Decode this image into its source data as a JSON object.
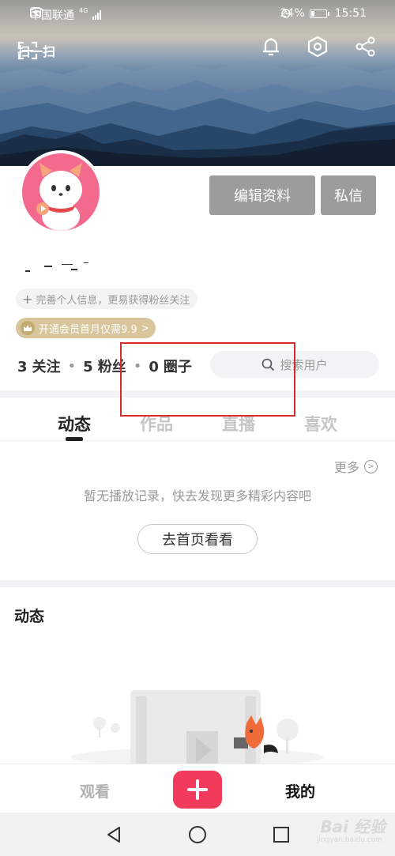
{
  "status_bar": {
    "carrier": "中国联通",
    "network": "4G",
    "battery": "24%",
    "time": "15:51",
    "battery_level": 0.24
  },
  "header": {
    "scan_label": "扫一扫",
    "icons": [
      "scan-icon",
      "bell-icon",
      "settings-hex-icon",
      "share-icon"
    ]
  },
  "profile": {
    "edit_button": "编辑资料",
    "message_button": "私信",
    "complete_info_tip": "完善个人信息，更易获得粉丝关注",
    "vip_promo": "开通会员首月仅需9.9",
    "stats": [
      {
        "value": "3",
        "label": "关注"
      },
      {
        "value": "5",
        "label": "粉丝"
      },
      {
        "value": "0",
        "label": "圈子"
      }
    ],
    "search_placeholder": "搜索用户"
  },
  "tabs": [
    {
      "label": "动态",
      "active": true
    },
    {
      "label": "作品",
      "active": false
    },
    {
      "label": "直播",
      "active": false
    },
    {
      "label": "喜欢",
      "active": false
    }
  ],
  "history": {
    "more_label": "更多",
    "empty_text": "暂无播放记录，快去发现更多精彩内容吧",
    "go_home_button": "去首页看看"
  },
  "dynamic_section": {
    "title": "动态"
  },
  "bottom_nav": {
    "watch_label": "观看",
    "mine_label": "我的"
  },
  "watermark": {
    "text": "Bai 经验",
    "sub": "jingyan.baidu.com"
  },
  "colors": {
    "accent": "#f23b5c",
    "button_gray": "#9c9c9c",
    "vip_gold": "#d8c59c",
    "highlight_box": "#d42b2b"
  }
}
